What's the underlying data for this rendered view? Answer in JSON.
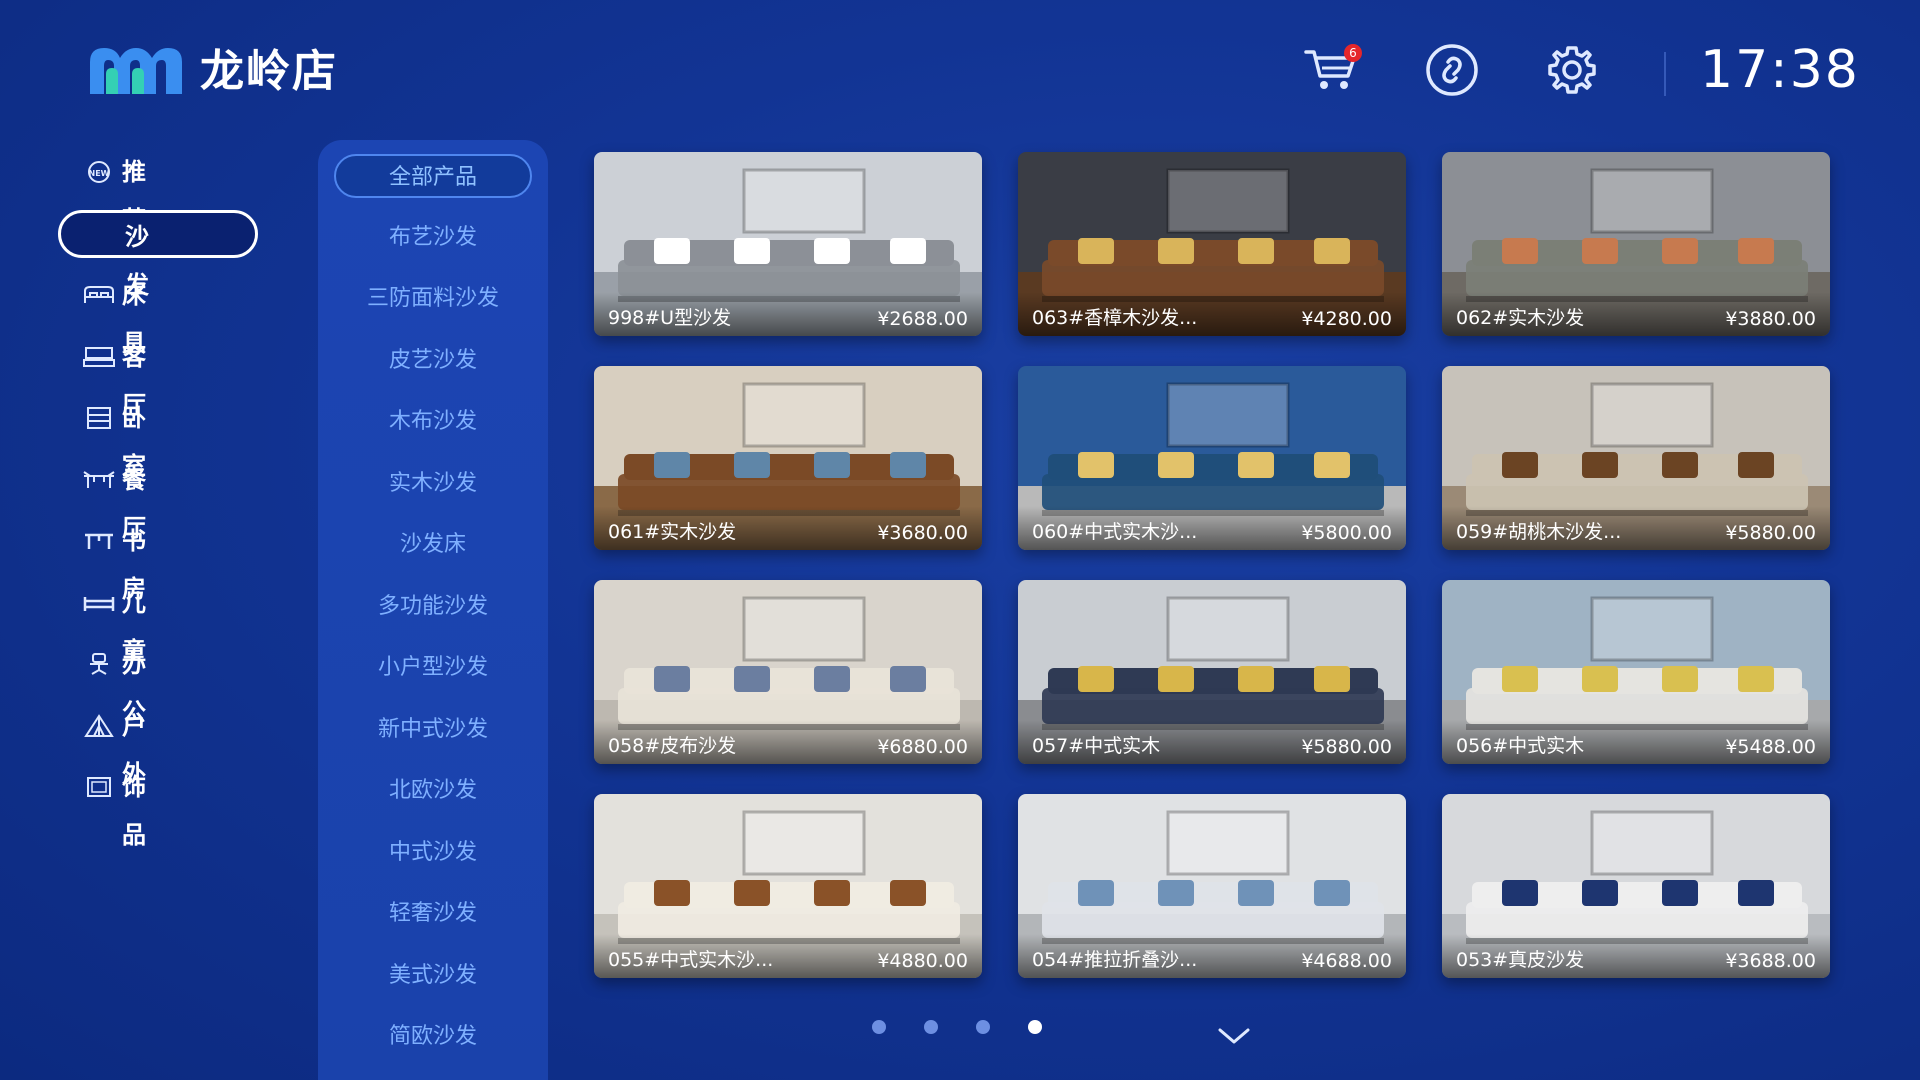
{
  "header": {
    "store_name": "龙岭店",
    "cart_badge": "6",
    "time": "17:38",
    "icons": [
      "logo-icon",
      "cart-icon",
      "link-icon",
      "gear-icon"
    ]
  },
  "nav": {
    "items": [
      {
        "label": "推荐",
        "icon": "new-badge-icon"
      },
      {
        "label": "沙发",
        "icon": "",
        "active": true
      },
      {
        "label": "床具",
        "icon": "bed-icon"
      },
      {
        "label": "客厅",
        "icon": "tv-cabinet-icon"
      },
      {
        "label": "卧室",
        "icon": "wardrobe-icon"
      },
      {
        "label": "餐厅",
        "icon": "dining-icon"
      },
      {
        "label": "书房",
        "icon": "desk-icon"
      },
      {
        "label": "儿童",
        "icon": "kids-bed-icon"
      },
      {
        "label": "办公",
        "icon": "office-chair-icon"
      },
      {
        "label": "户外",
        "icon": "tent-icon"
      },
      {
        "label": "饰品",
        "icon": "frame-icon"
      }
    ]
  },
  "subnav": {
    "items": [
      {
        "label": "全部产品",
        "active": true
      },
      {
        "label": "布艺沙发"
      },
      {
        "label": "三防面料沙发"
      },
      {
        "label": "皮艺沙发"
      },
      {
        "label": "木布沙发"
      },
      {
        "label": "实木沙发"
      },
      {
        "label": "沙发床"
      },
      {
        "label": "多功能沙发"
      },
      {
        "label": "小户型沙发"
      },
      {
        "label": "新中式沙发"
      },
      {
        "label": "北欧沙发"
      },
      {
        "label": "中式沙发"
      },
      {
        "label": "轻奢沙发"
      },
      {
        "label": "美式沙发"
      },
      {
        "label": "简欧沙发"
      }
    ]
  },
  "products": [
    {
      "name": "998#U型沙发",
      "price": "¥2688.00",
      "wall": "#ccd0d6",
      "floor": "#9aa0a8",
      "sofa": "#8c9097",
      "accent": "#ffffff"
    },
    {
      "name": "063#香樟木沙发...",
      "price": "¥4280.00",
      "wall": "#3a3d45",
      "floor": "#5a3a22",
      "sofa": "#7a4a2a",
      "accent": "#d9b45a"
    },
    {
      "name": "062#实木沙发",
      "price": "¥3880.00",
      "wall": "#8c8f95",
      "floor": "#6e6a64",
      "sofa": "#7b7f76",
      "accent": "#c77a4f"
    },
    {
      "name": "061#实木沙发",
      "price": "¥3680.00",
      "wall": "#d8cfc0",
      "floor": "#8a6a48",
      "sofa": "#7b4a26",
      "accent": "#5f86a8"
    },
    {
      "name": "060#中式实木沙...",
      "price": "¥5800.00",
      "wall": "#2a5a9a",
      "floor": "#b9b9b9",
      "sofa": "#1f4e7a",
      "accent": "#e2c26a"
    },
    {
      "name": "059#胡桃木沙发...",
      "price": "¥5880.00",
      "wall": "#c7c2ba",
      "floor": "#9b8a76",
      "sofa": "#ccc3b2",
      "accent": "#6b4423"
    },
    {
      "name": "058#皮布沙发",
      "price": "¥6880.00",
      "wall": "#d9d4cc",
      "floor": "#bdb8b0",
      "sofa": "#e8e3d8",
      "accent": "#6b7ea0"
    },
    {
      "name": "057#中式实木",
      "price": "¥5880.00",
      "wall": "#c9cdd2",
      "floor": "#8a8c90",
      "sofa": "#2f3a54",
      "accent": "#d8b64a"
    },
    {
      "name": "056#中式实木",
      "price": "¥5488.00",
      "wall": "#9fb3c4",
      "floor": "#a7a9ab",
      "sofa": "#e5e4e0",
      "accent": "#d9c050"
    },
    {
      "name": "055#中式实木沙...",
      "price": "¥4880.00",
      "wall": "#e3e1dc",
      "floor": "#c5c2bb",
      "sofa": "#f0ece2",
      "accent": "#8a5228"
    },
    {
      "name": "054#推拉折叠沙...",
      "price": "¥4688.00",
      "wall": "#e0e2e4",
      "floor": "#b3b6b9",
      "sofa": "#dfe3e8",
      "accent": "#6f92b8"
    },
    {
      "name": "053#真皮沙发",
      "price": "¥3688.00",
      "wall": "#d7d9dc",
      "floor": "#b9bcc0",
      "sofa": "#eeeeee",
      "accent": "#1e3570"
    }
  ],
  "pagination": {
    "pages": 4,
    "current": 4
  }
}
